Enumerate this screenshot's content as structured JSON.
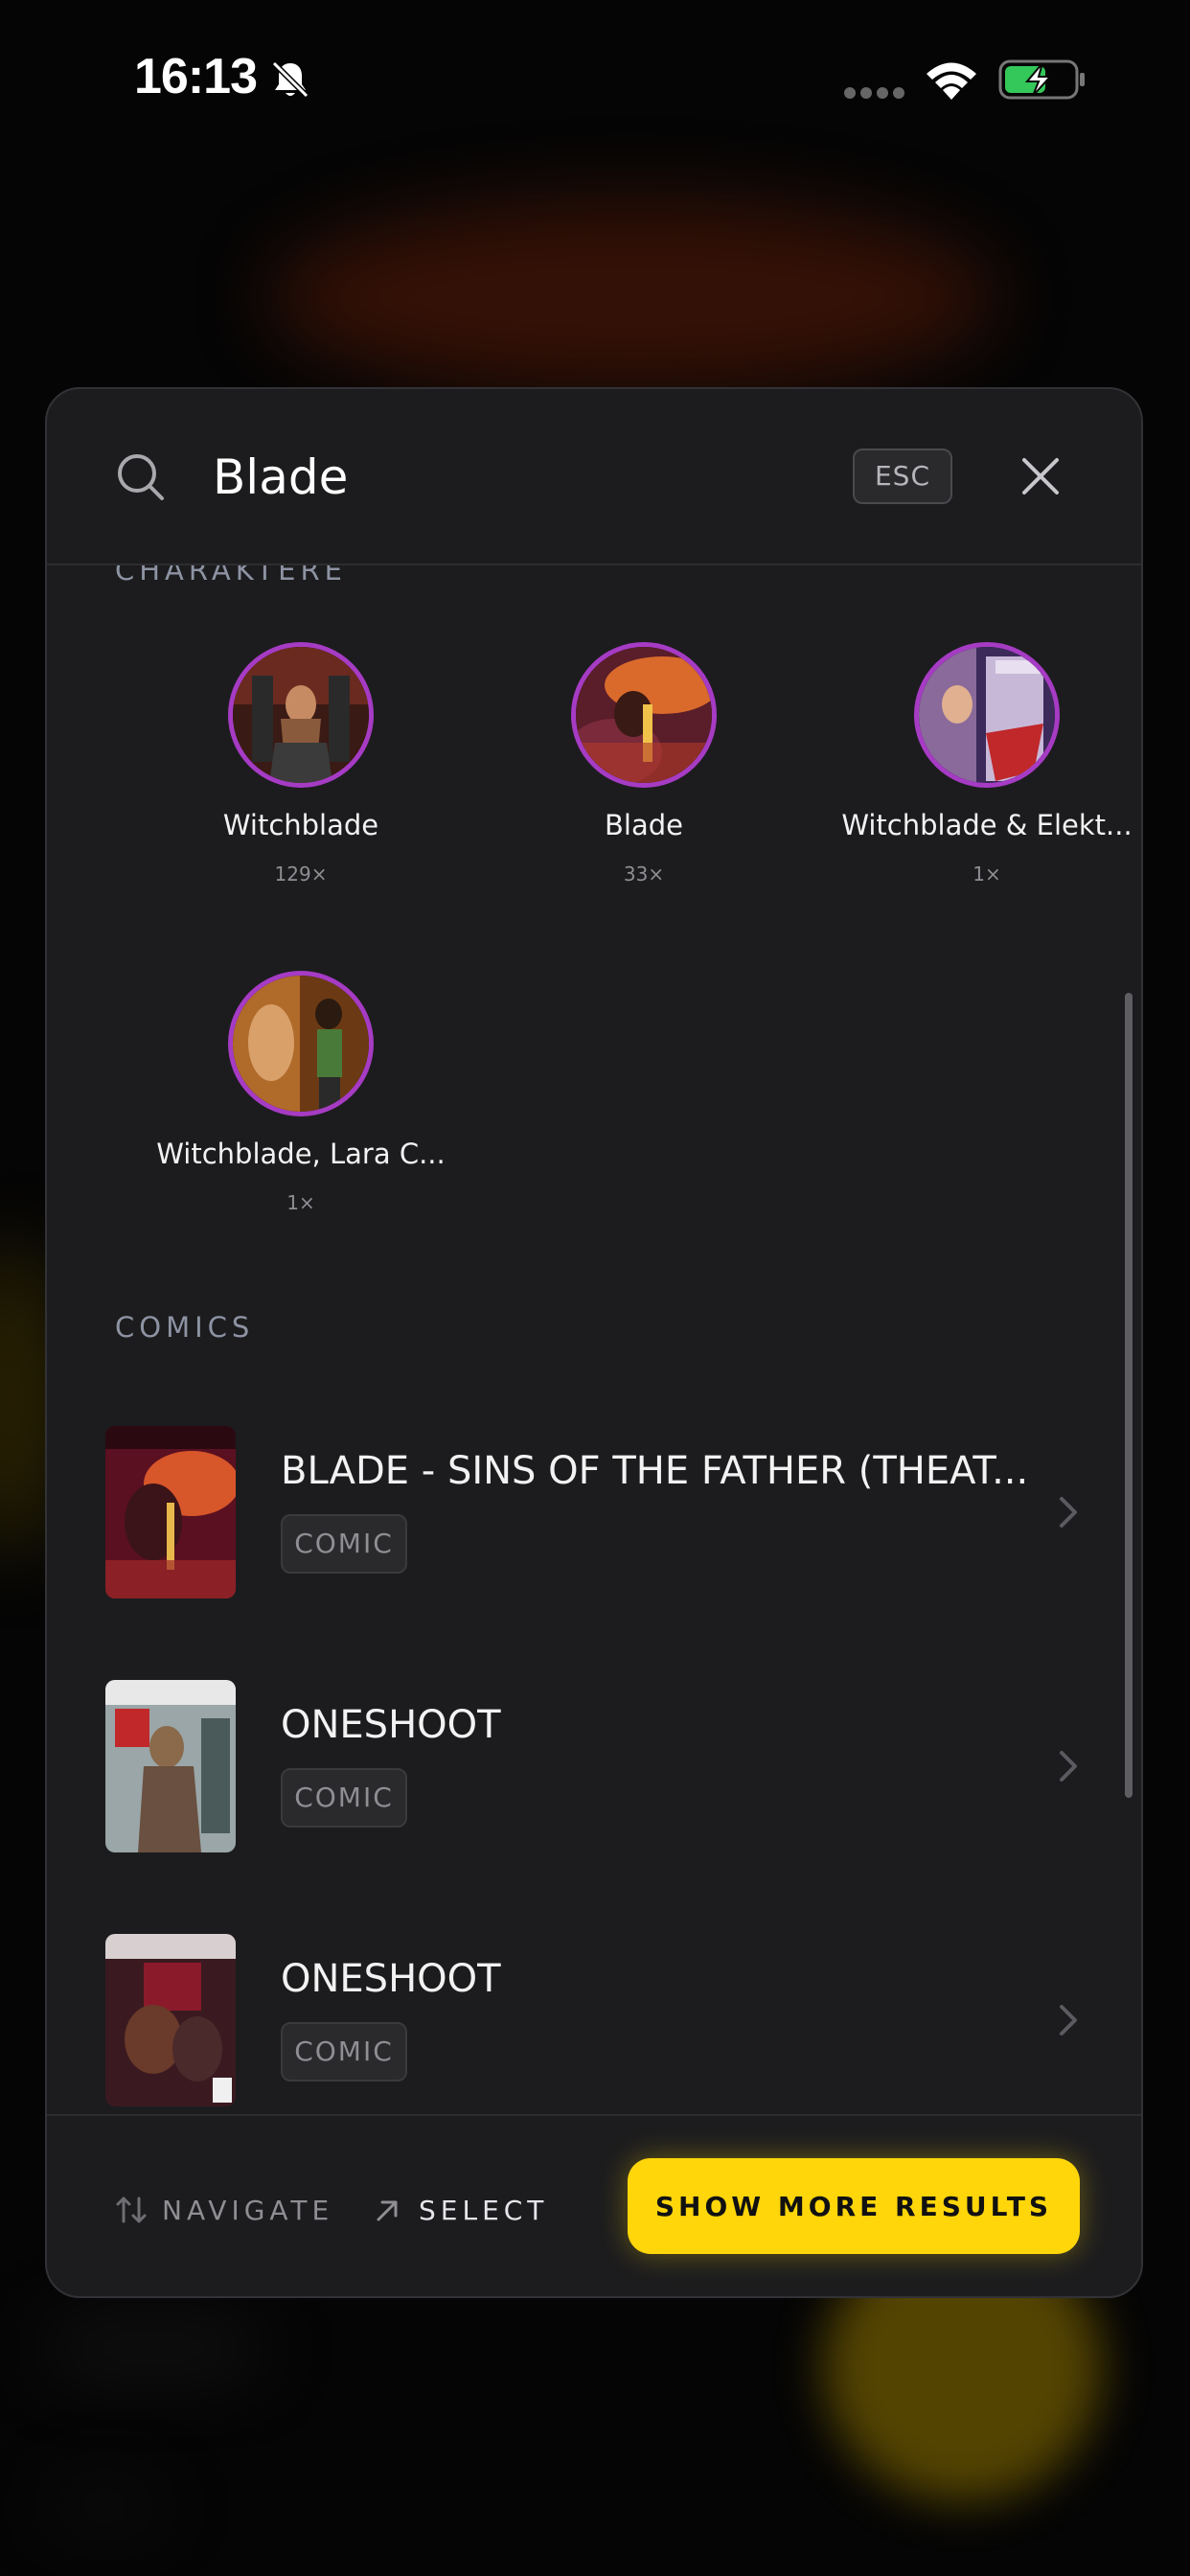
{
  "status_bar": {
    "time": "16:13"
  },
  "search": {
    "query": "Blade",
    "esc_label": "ESC"
  },
  "sections": {
    "characters": "CHARAKTERE",
    "comics": "COMICS"
  },
  "characters": [
    {
      "name": "Witchblade",
      "count": "129×"
    },
    {
      "name": "Blade",
      "count": "33×"
    },
    {
      "name": "Witchblade & Elekt...",
      "count": "1×"
    },
    {
      "name": "Witchblade, Lara C...",
      "count": "1×"
    }
  ],
  "comics": [
    {
      "title": "BLADE - SINS OF THE FATHER (THEAT...",
      "type": "COMIC"
    },
    {
      "title": "ONESHOOT",
      "type": "COMIC"
    },
    {
      "title": "ONESHOOT",
      "type": "COMIC"
    }
  ],
  "footer": {
    "navigate_label": "NAVIGATE",
    "select_label": "SELECT",
    "show_more_label": "SHOW MORE RESULTS"
  },
  "colors": {
    "accent": "#ffd60a",
    "avatar_ring": "#a63bc4",
    "panel": "#1c1c1e"
  }
}
